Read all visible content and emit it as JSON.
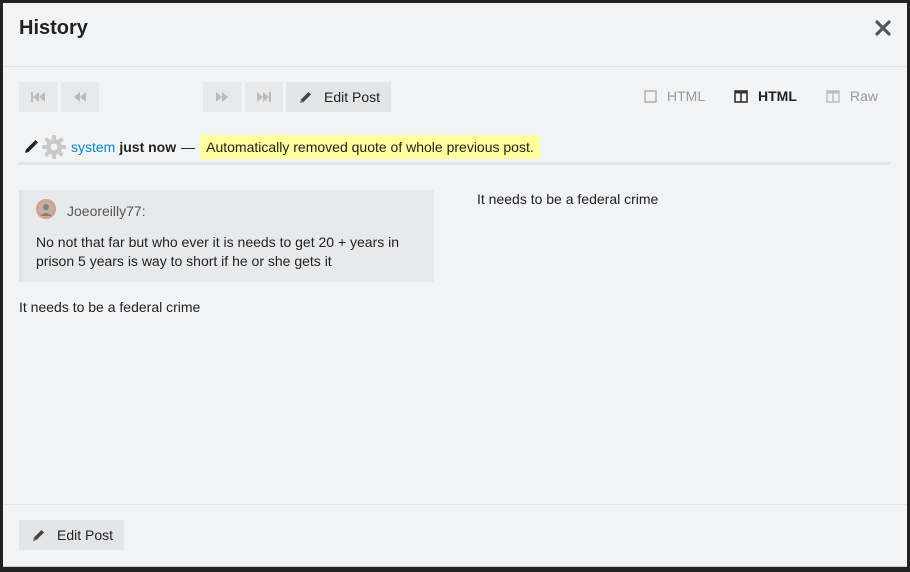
{
  "modal": {
    "title": "History"
  },
  "toolbar": {
    "edit_label": "Edit Post",
    "modes": [
      {
        "label": "HTML",
        "state": "inactive"
      },
      {
        "label": "HTML",
        "state": "active"
      },
      {
        "label": "Raw",
        "state": "inactive"
      }
    ]
  },
  "revision": {
    "user": "system",
    "when": "just now",
    "dash": "—",
    "reason": "Automatically removed quote of whole previous post."
  },
  "left_pane": {
    "quote_author": "Joeoreilly77:",
    "quote_body": "No not that far but who ever it is needs to get 20 + years in prison 5 years is way to short if he or she gets it",
    "text": "It needs to be a federal crime"
  },
  "right_pane": {
    "text": "It needs to be a federal crime"
  },
  "footer": {
    "edit_label": "Edit Post"
  },
  "colors": {
    "accent_link": "#0a85c6",
    "highlight": "#ffff9e"
  }
}
